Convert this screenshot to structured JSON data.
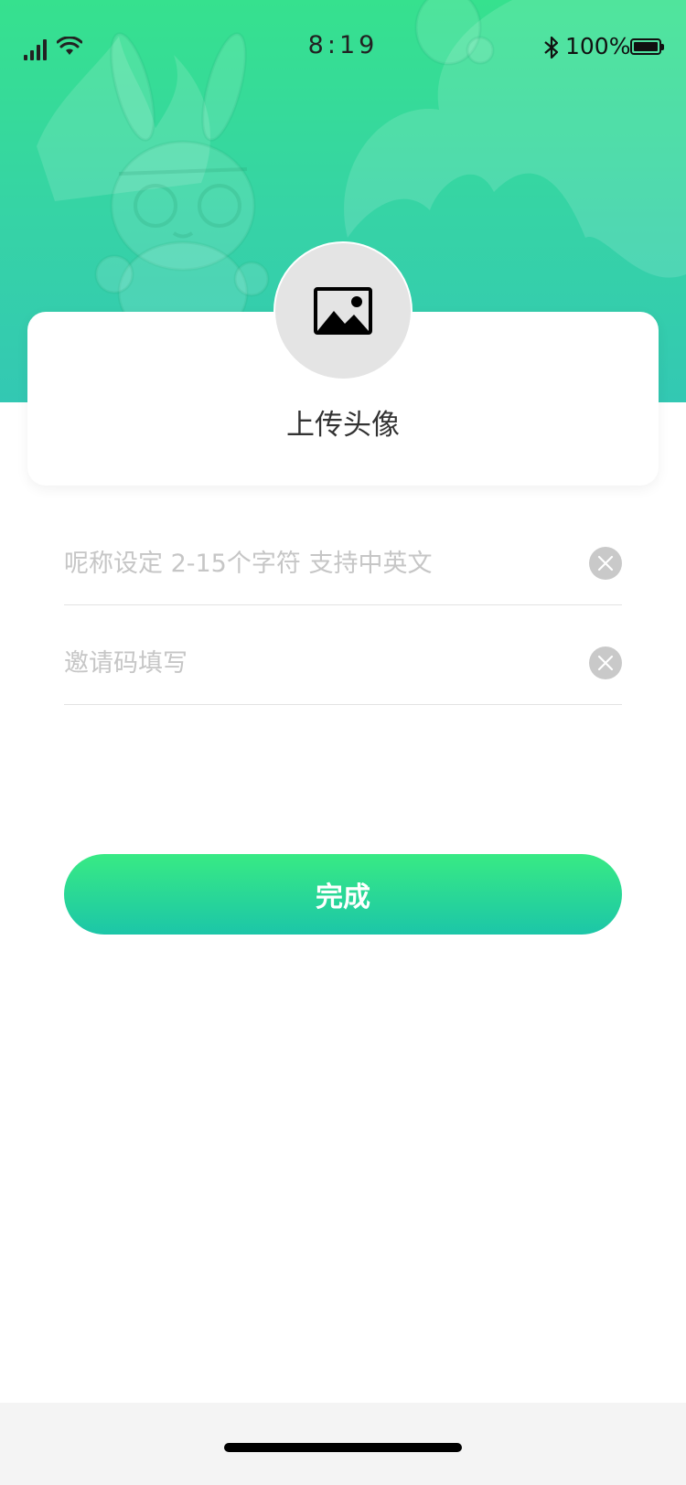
{
  "status_bar": {
    "time": "8:19",
    "battery_percent": "100%",
    "signal_icon": "signal-bars-icon",
    "wifi_icon": "wifi-icon",
    "bluetooth_icon": "bluetooth-icon",
    "battery_icon": "battery-icon"
  },
  "header": {
    "background_colors": [
      "#36e18e",
      "#33c8b3"
    ],
    "decoration": "rabbit-mascot-watermark"
  },
  "profile": {
    "avatar_icon": "image-placeholder-icon",
    "upload_label": "上传头像"
  },
  "form": {
    "nickname": {
      "value": "",
      "placeholder": "呢称设定 2-15个字符 支持中英文",
      "clear_icon": "clear-icon"
    },
    "invite_code": {
      "value": "",
      "placeholder": "邀请码填写",
      "clear_icon": "clear-icon"
    }
  },
  "actions": {
    "done_label": "完成",
    "done_colors": [
      "#38ea84",
      "#1cc6a8"
    ]
  }
}
